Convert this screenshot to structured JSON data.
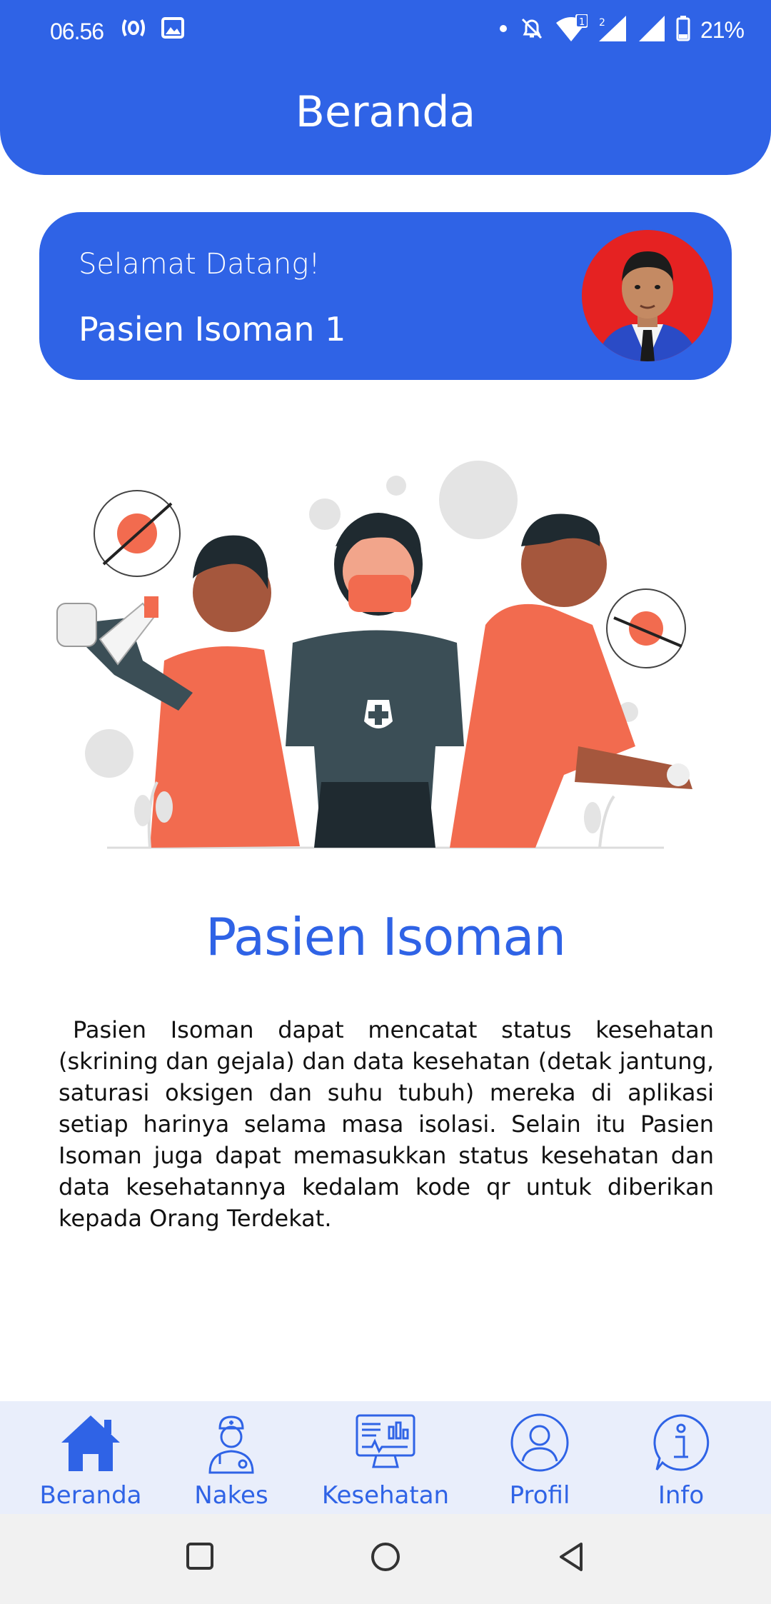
{
  "status_bar": {
    "time": "06.56",
    "battery": "21%",
    "left_icons": [
      "hotspot-icon",
      "image-icon"
    ],
    "right_icons": [
      "dot-icon",
      "mute-icon",
      "wifi-icon",
      "signal-1-icon",
      "signal-2-icon",
      "battery-icon"
    ]
  },
  "header": {
    "title": "Beranda"
  },
  "welcome": {
    "greeting": "Selamat Datang!",
    "name": "Pasien Isoman 1"
  },
  "section": {
    "title": "Pasien Isoman",
    "body": "Pasien Isoman dapat mencatat status kesehatan (skrining dan gejala) dan data kesehatan (detak jantung, saturasi oksigen dan suhu tubuh) mereka di aplikasi setiap harinya selama masa isolasi. Selain itu Pasien Isoman juga dapat memasukkan status kesehatan dan data kesehatannya kedalam kode qr untuk diberikan kepada Orang Terdekat."
  },
  "bottom_nav": {
    "items": [
      {
        "label": "Beranda",
        "icon": "home-icon",
        "active": true
      },
      {
        "label": "Nakes",
        "icon": "doctor-icon",
        "active": false
      },
      {
        "label": "Kesehatan",
        "icon": "monitor-icon",
        "active": false
      },
      {
        "label": "Profil",
        "icon": "person-icon",
        "active": false
      },
      {
        "label": "Info",
        "icon": "info-icon",
        "active": false
      }
    ]
  },
  "colors": {
    "primary": "#2f63e6",
    "nav_background": "#e9eefb",
    "avatar_background": "#e52222",
    "accent_illustration": "#f26b4f"
  }
}
